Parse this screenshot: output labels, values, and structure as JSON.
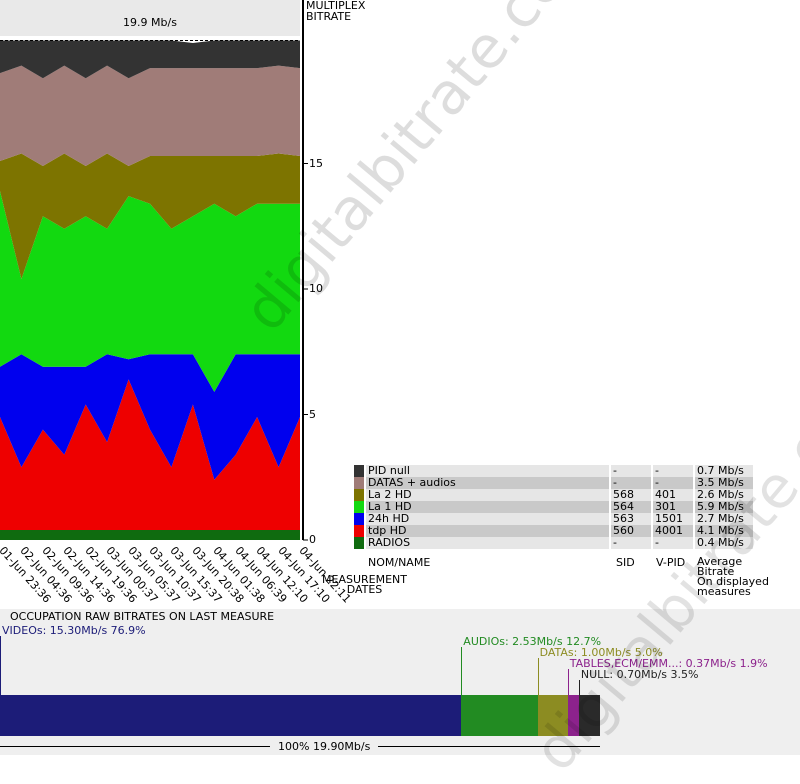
{
  "peak_label": "19.9 Mb/s",
  "axis_title_lines": [
    "MULTIPLEX",
    "BITRATE"
  ],
  "x_axis_title_lines": [
    "MEASUREMENT",
    "DATES"
  ],
  "legend_headers": {
    "name": "NOM/NAME",
    "sid": "SID",
    "vpid": "V-PID",
    "bitrate_lines": [
      "Average",
      "Bitrate",
      "On displayed",
      "measures"
    ]
  },
  "legend": [
    {
      "name": "PID null",
      "sid": "-",
      "vpid": "-",
      "bitrate": "0.7 Mb/s",
      "color": "#333333"
    },
    {
      "name": "DATAS + audios",
      "sid": "-",
      "vpid": "-",
      "bitrate": "3.5 Mb/s",
      "color": "#a07c78"
    },
    {
      "name": "La 2 HD",
      "sid": "568",
      "vpid": "401",
      "bitrate": "2.6 Mb/s",
      "color": "#7d7400"
    },
    {
      "name": "La 1 HD",
      "sid": "564",
      "vpid": "301",
      "bitrate": "5.9 Mb/s",
      "color": "#12d910"
    },
    {
      "name": "24h HD",
      "sid": "563",
      "vpid": "1501",
      "bitrate": "2.7 Mb/s",
      "color": "#0000ee"
    },
    {
      "name": "tdp HD",
      "sid": "560",
      "vpid": "4001",
      "bitrate": "4.1 Mb/s",
      "color": "#ee0000"
    },
    {
      "name": "RADIOS",
      "sid": "-",
      "vpid": "-",
      "bitrate": "0.4 Mb/s",
      "color": "#0f6b0f"
    }
  ],
  "occupation": {
    "title": "OCCUPATION RAW BITRATES ON LAST MEASURE",
    "total_label": "100%  19.90Mb/s",
    "segments": [
      {
        "label": "VIDEOs: 15.30Mb/s  76.9%",
        "mbps": 15.3,
        "color": "#1c1c78",
        "text_color": "#1c1c78"
      },
      {
        "label": "AUDIOs: 2.53Mb/s  12.7%",
        "mbps": 2.53,
        "color": "#228b22",
        "text_color": "#228b22"
      },
      {
        "label": "DATAs: 1.00Mb/s  5.0%",
        "mbps": 1.0,
        "color": "#8c8c22",
        "text_color": "#8c8c22"
      },
      {
        "label": "TABLES,ECM/EMM...: 0.37Mb/s  1.9%",
        "mbps": 0.37,
        "color": "#8c228c",
        "text_color": "#8c228c"
      },
      {
        "label": "NULL: 0.70Mb/s  3.5%",
        "mbps": 0.7,
        "color": "#2a2a2a",
        "text_color": "#222222"
      }
    ]
  },
  "watermark": "digitalbitrate.com",
  "chart_data": {
    "type": "area",
    "title": "",
    "ylabel": "MULTIPLEX BITRATE",
    "xlabel": "MEASUREMENT DATES",
    "ylim": [
      0,
      20
    ],
    "yticks": [
      0,
      5,
      10,
      15
    ],
    "peak_value_label": "19.9 Mb/s",
    "x": [
      "01-Jun 23:36",
      "02-Jun 04:36",
      "02-Jun 09:36",
      "02-Jun 14:36",
      "02-Jun 19:36",
      "03-Jun 00:37",
      "03-Jun 05:37",
      "03-Jun 10:37",
      "03-Jun 15:37",
      "03-Jun 20:38",
      "04-Jun 01:38",
      "04-Jun 06:39",
      "04-Jun 12:10",
      "04-Jun 17:10",
      "04-Jun 22:11"
    ],
    "series": [
      {
        "name": "RADIOS",
        "color": "#0f6b0f",
        "values": [
          0.4,
          0.4,
          0.4,
          0.4,
          0.4,
          0.4,
          0.4,
          0.4,
          0.4,
          0.4,
          0.4,
          0.4,
          0.4,
          0.4,
          0.4
        ]
      },
      {
        "name": "tdp HD",
        "color": "#ee0000",
        "values": [
          4.5,
          2.5,
          4.0,
          3.0,
          5.0,
          3.5,
          6.0,
          4.0,
          2.5,
          5.0,
          2.0,
          3.0,
          4.5,
          2.5,
          4.5
        ]
      },
      {
        "name": "24h HD",
        "color": "#0000ee",
        "values": [
          2.0,
          4.5,
          2.5,
          3.5,
          1.5,
          3.5,
          0.8,
          3.0,
          4.5,
          2.0,
          3.5,
          4.0,
          2.5,
          4.5,
          2.5
        ]
      },
      {
        "name": "La 1 HD",
        "color": "#12d910",
        "values": [
          7.0,
          3.0,
          6.0,
          5.5,
          6.0,
          5.0,
          6.5,
          6.0,
          5.0,
          5.5,
          7.5,
          5.5,
          6.0,
          6.0,
          6.0
        ]
      },
      {
        "name": "La 2 HD",
        "color": "#7d7400",
        "values": [
          1.2,
          5.0,
          2.0,
          3.0,
          2.0,
          3.0,
          1.2,
          1.9,
          2.9,
          2.4,
          1.9,
          2.4,
          1.9,
          2.0,
          1.9
        ]
      },
      {
        "name": "DATAS + audios",
        "color": "#a07c78",
        "values": [
          3.5,
          3.5,
          3.5,
          3.5,
          3.5,
          3.5,
          3.5,
          3.5,
          3.5,
          3.5,
          3.5,
          3.5,
          3.5,
          3.5,
          3.5
        ]
      },
      {
        "name": "PID null",
        "color": "#333333",
        "values": [
          1.3,
          1.0,
          1.5,
          1.0,
          1.5,
          1.0,
          1.5,
          1.1,
          1.1,
          1.0,
          1.1,
          1.1,
          1.1,
          1.0,
          1.1
        ]
      }
    ]
  }
}
